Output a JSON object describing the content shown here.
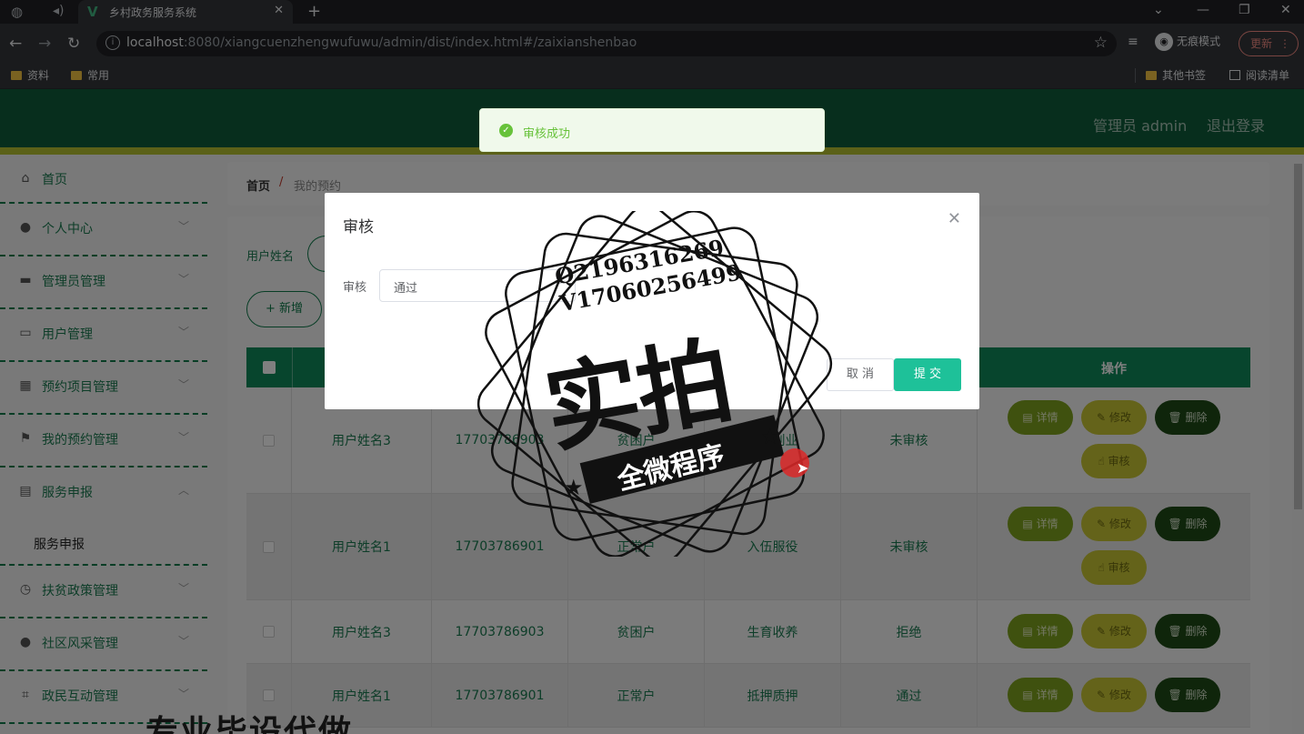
{
  "browser": {
    "tab_title": "乡村政务服务系统",
    "url_host": "localhost",
    "url_rest": ":8080/xiangcuenzhengwufuwu/admin/dist/index.html#/zaixianshenbao",
    "incognito_label": "无痕模式",
    "update_label": "更新",
    "bookmarks": [
      "资料",
      "常用"
    ],
    "bookmarks_right": [
      "其他书签",
      "阅读清单"
    ]
  },
  "header": {
    "admin_label": "管理员 admin",
    "logout_label": "退出登录"
  },
  "sidebar": {
    "items": [
      {
        "label": "首页",
        "icon": "home-icon"
      },
      {
        "label": "个人中心",
        "icon": "user-icon"
      },
      {
        "label": "管理员管理",
        "icon": "briefcase-icon"
      },
      {
        "label": "用户管理",
        "icon": "chat-icon"
      },
      {
        "label": "预约项目管理",
        "icon": "grid-icon"
      },
      {
        "label": "我的预约管理",
        "icon": "flag-icon"
      },
      {
        "label": "服务申报",
        "icon": "message-icon"
      },
      {
        "label": "扶贫政策管理",
        "icon": "clock-icon"
      },
      {
        "label": "社区风采管理",
        "icon": "person-icon"
      },
      {
        "label": "政民互动管理",
        "icon": "crop-icon"
      }
    ],
    "sub_item": "服务申报"
  },
  "breadcrumb": {
    "home": "首页",
    "sep": "/",
    "current": "我的预约"
  },
  "search": {
    "label": "用户姓名"
  },
  "add_button": "+ 新增",
  "table": {
    "op_header": "操作",
    "rows": [
      {
        "name": "用户姓名3",
        "phone": "17703786903",
        "type": "贫困户",
        "item": "就业创业",
        "status": "未审核",
        "audit": true
      },
      {
        "name": "用户姓名1",
        "phone": "17703786901",
        "type": "正常户",
        "item": "入伍服役",
        "status": "未审核",
        "audit": true
      },
      {
        "name": "用户姓名3",
        "phone": "17703786903",
        "type": "贫困户",
        "item": "生育收养",
        "status": "拒绝",
        "audit": false
      },
      {
        "name": "用户姓名1",
        "phone": "17703786901",
        "type": "正常户",
        "item": "抵押质押",
        "status": "通过",
        "audit": false
      }
    ],
    "btn_detail": "详情",
    "btn_edit": "修改",
    "btn_delete": "删除",
    "btn_audit": "审核"
  },
  "toast": {
    "message": "审核成功"
  },
  "dialog": {
    "title": "审核",
    "field_label": "审核",
    "select_value": "通过",
    "cancel": "取 消",
    "submit": "提 交"
  },
  "watermark": {
    "contact_q": "Q2196316269",
    "contact_v": "V17060256499",
    "big_text": "实拍",
    "ribbon_text": "全微程序",
    "bottom_text": "专业毕设代做"
  }
}
